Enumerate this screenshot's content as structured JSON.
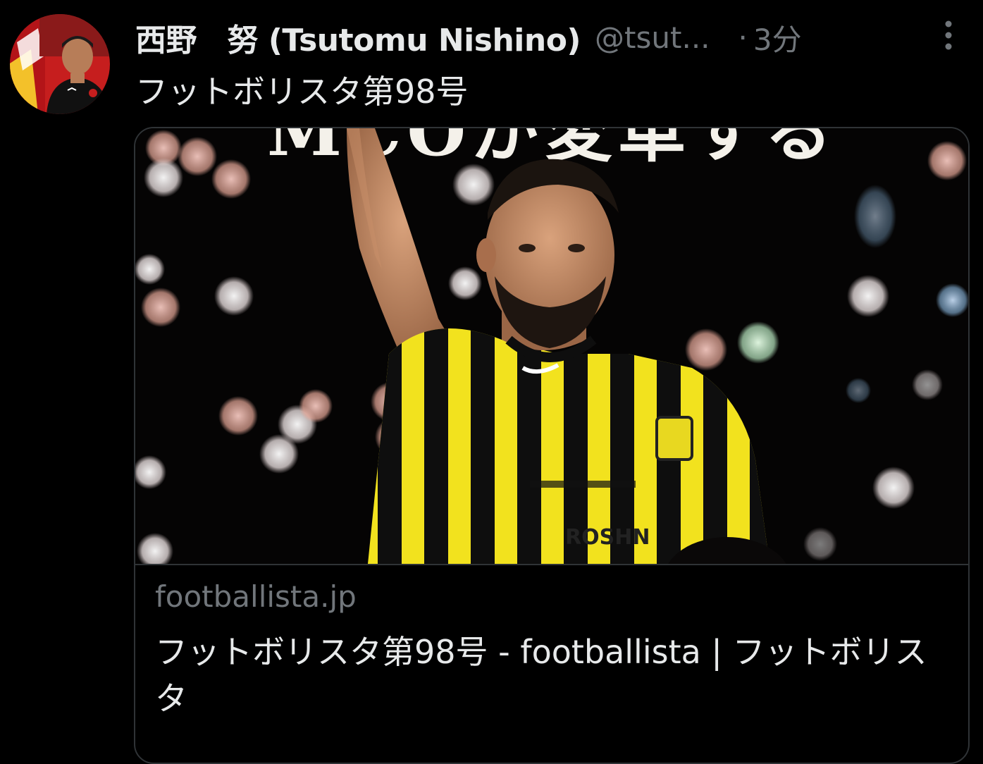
{
  "tweet": {
    "author": {
      "display_name": "西野　努 (Tsutomu Nishino)",
      "handle": "@tsut...",
      "avatar_icon": "profile-photo"
    },
    "separator": "·",
    "time": "3分",
    "more_icon": "more-vertical-icon",
    "text": "フットボリスタ第98号"
  },
  "card": {
    "image_overlay_text": "MCOが変革する",
    "domain": "footballista.jp",
    "title": "フットボリスタ第98号 - footballista | フットボリスタ"
  },
  "colors": {
    "background": "#000000",
    "primary_text": "#e7e9ea",
    "secondary_text": "#71767b",
    "border": "#2f3336",
    "jersey_yellow": "#f2e21e"
  }
}
